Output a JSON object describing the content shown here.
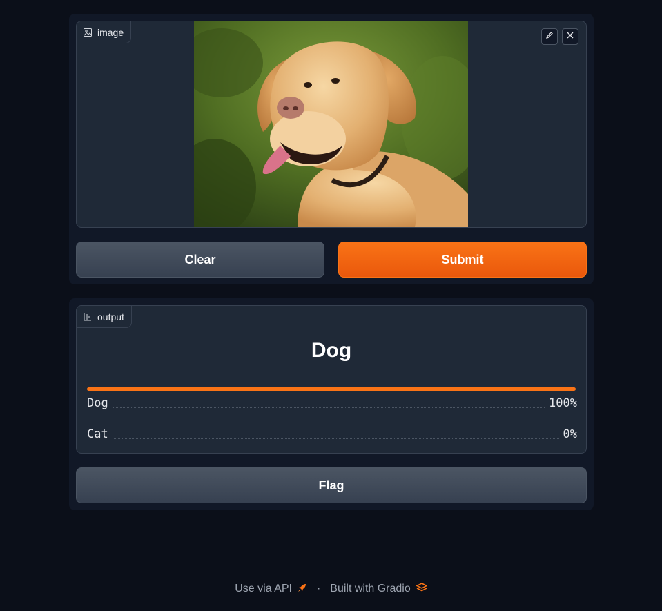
{
  "input_block": {
    "label": "image",
    "label_icon": "image-icon",
    "edit_icon": "pencil-icon",
    "close_icon": "close-icon"
  },
  "buttons": {
    "clear": "Clear",
    "submit": "Submit",
    "flag": "Flag"
  },
  "output_block": {
    "label": "output",
    "label_icon": "bar-chart-icon",
    "predicted": "Dog",
    "confidences": [
      {
        "label": "Dog",
        "value": "100%",
        "fraction": 1.0
      },
      {
        "label": "Cat",
        "value": "0%",
        "fraction": 0.0
      }
    ]
  },
  "footer": {
    "api_link": "Use via API",
    "separator": "·",
    "built_with": "Built with Gradio"
  },
  "colors": {
    "accent": "#f97316",
    "background": "#0b0f19",
    "panel": "#111827",
    "block": "#1f2937"
  }
}
